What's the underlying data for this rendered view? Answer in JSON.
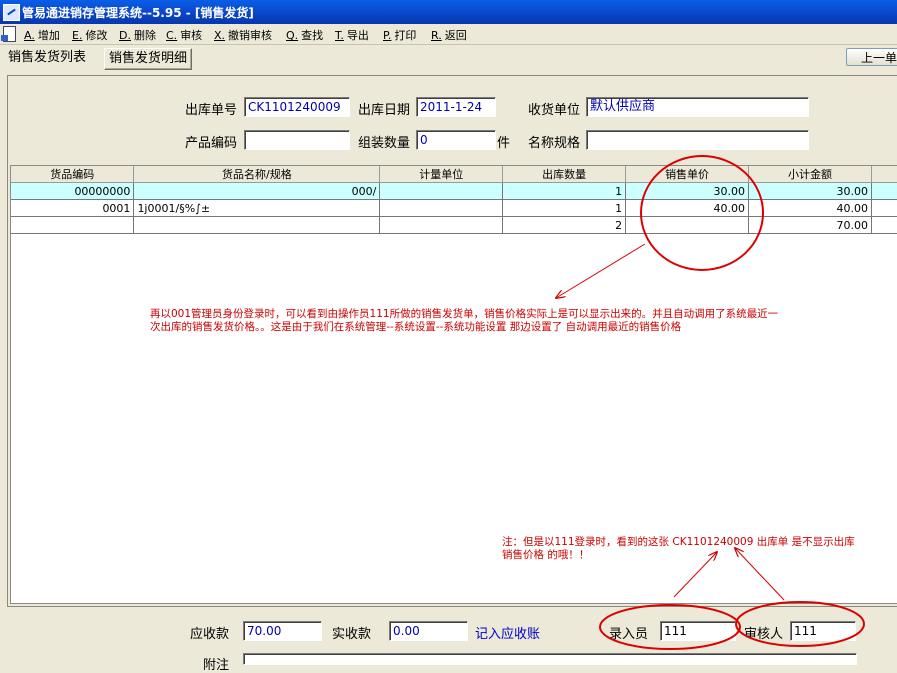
{
  "window": {
    "title": "管易通进销存管理系统--5.95 - [销售发货]"
  },
  "menu": [
    {
      "key": "A.",
      "label": "增加"
    },
    {
      "key": "E.",
      "label": "修改"
    },
    {
      "key": "D.",
      "label": "删除"
    },
    {
      "key": "C.",
      "label": "审核"
    },
    {
      "key": "X.",
      "label": "撤销审核"
    },
    {
      "key": "Q.",
      "label": "查找"
    },
    {
      "key": "T.",
      "label": "导出"
    },
    {
      "key": "P.",
      "label": "打印"
    },
    {
      "key": "R.",
      "label": "返回"
    }
  ],
  "tabs": [
    {
      "label": "销售发货列表"
    },
    {
      "label": "销售发货明细"
    }
  ],
  "prev_button": "上一单",
  "header": {
    "order_no_label": "出库单号",
    "order_no": "CK1101240009",
    "date_label": "出库日期",
    "date": "2011-1-24",
    "receiver_label": "收货单位",
    "receiver": "默认供应商",
    "product_code_label": "产品编码",
    "product_code": "",
    "qty_label": "组装数量",
    "qty": "0",
    "qty_unit": "件",
    "spec_label": "名称规格",
    "spec": ""
  },
  "grid": {
    "columns": [
      "货品编码",
      "货品名称/规格",
      "计量单位",
      "出库数量",
      "销售单价",
      "小计金额"
    ],
    "rows": [
      {
        "code": "00000000",
        "name": "000/",
        "unit": "",
        "qty": "1",
        "price": "30.00",
        "amount": "30.00"
      },
      {
        "code": "0001",
        "name": "1j0001/§%∫±",
        "unit": "",
        "qty": "1",
        "price": "40.00",
        "amount": "40.00"
      },
      {
        "code": "",
        "name": "",
        "unit": "",
        "qty": "2",
        "price": "",
        "amount": "70.00"
      }
    ]
  },
  "annotations": {
    "main_line1": "再以001管理员身份登录时，可以看到由操作员111所做的销售发货单，销售价格实际上是可以显示出来的。并且自动调用了系统最近一",
    "main_line2": "次出库的销售发货价格。。这是由于我们在系统管理--系统设置--系统功能设置  那边设置了  自动调用最近的销售价格",
    "bottom_line1": "注：但是以111登录时，看到的这张 CK1101240009 出库单 是不显示出库",
    "bottom_line2": "销售价格 的哦！！",
    "color": "#CC0000"
  },
  "footer": {
    "receivable_label": "应收款",
    "receivable": "70.00",
    "received_label": "实收款",
    "received": "0.00",
    "post_link": "记入应收账",
    "entry_label": "录入员",
    "entry": "111",
    "auditor_label": "审核人",
    "auditor": "111",
    "remark_label": "附注"
  }
}
